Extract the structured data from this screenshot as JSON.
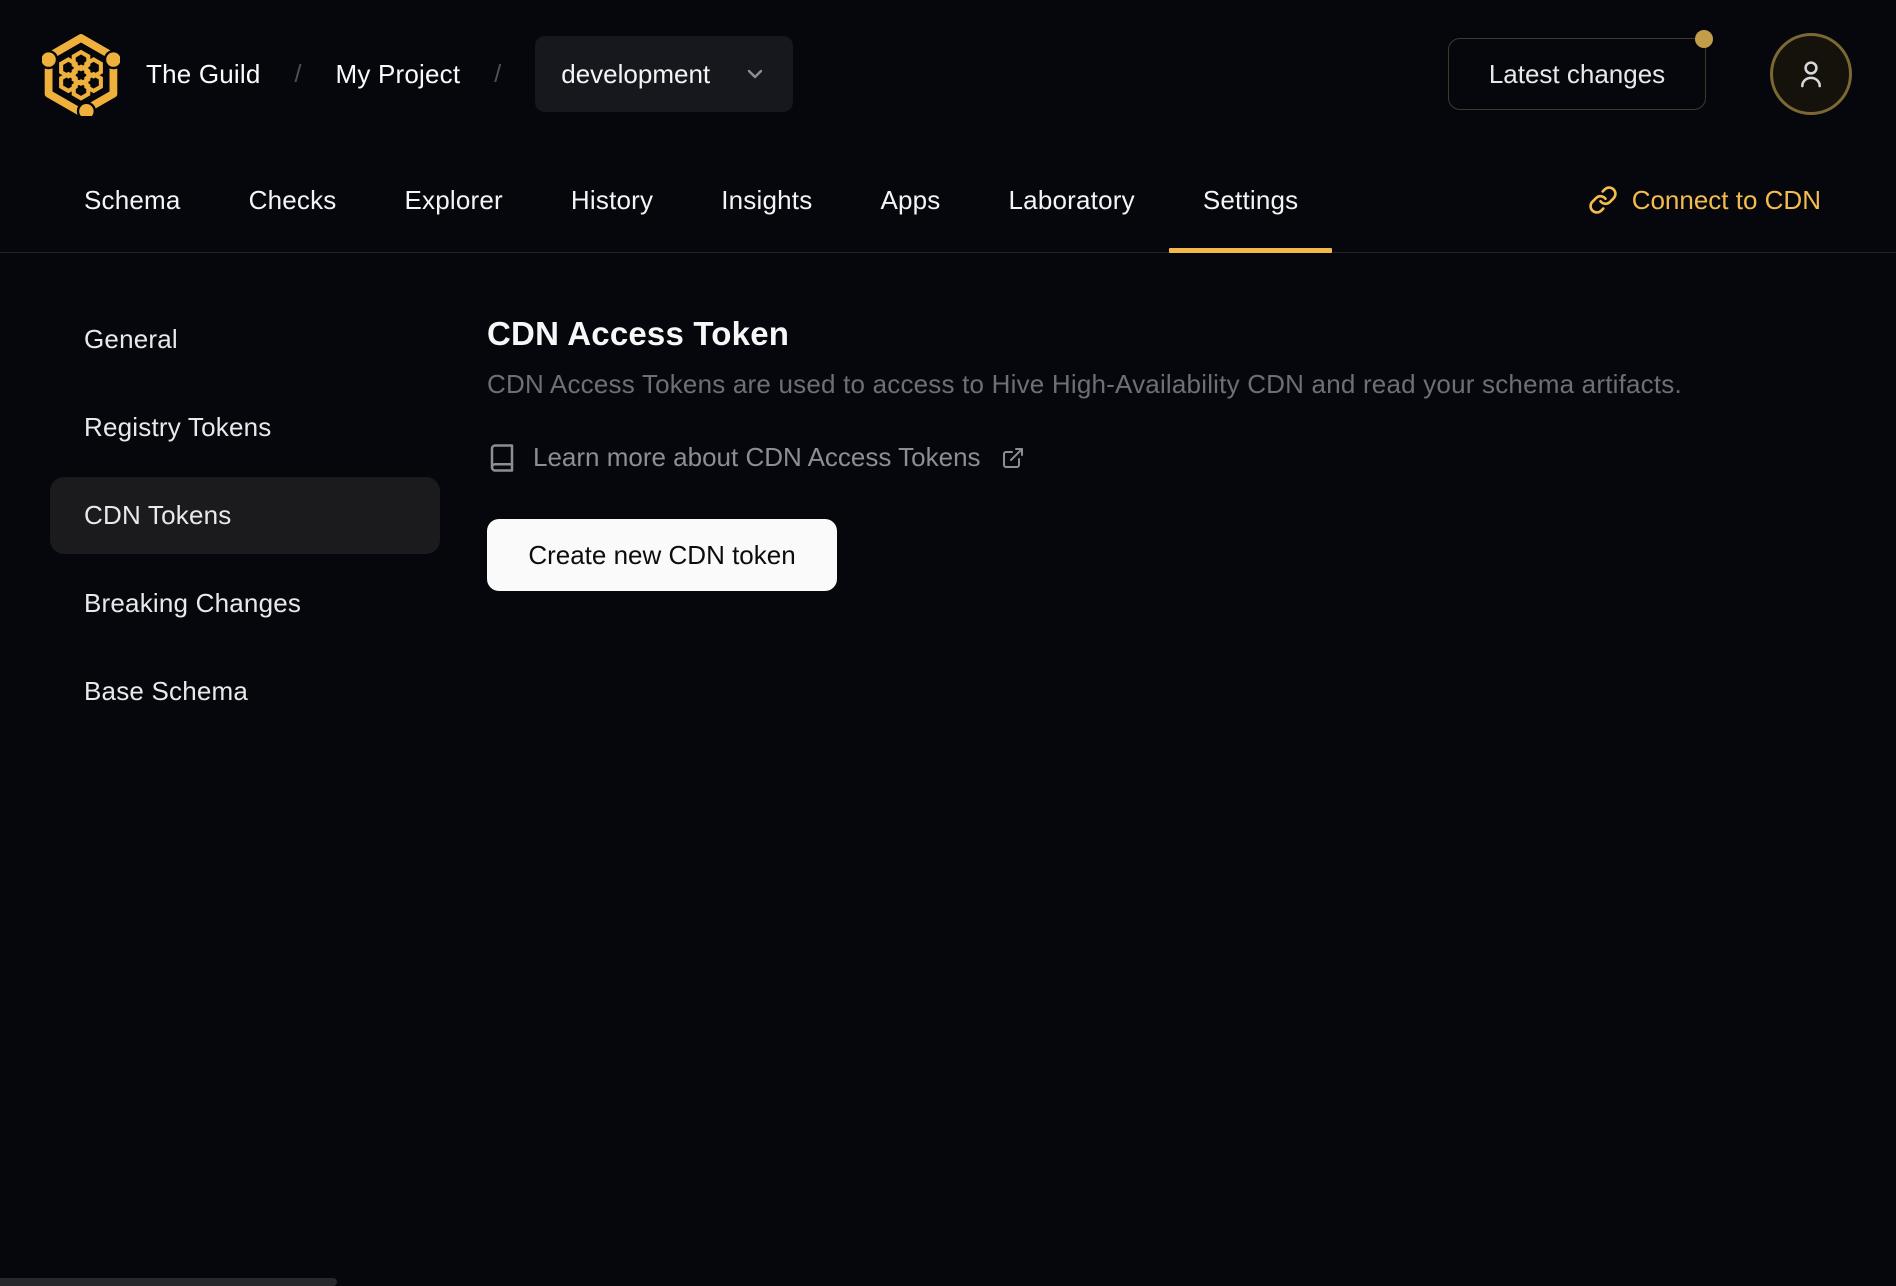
{
  "colors": {
    "accent_gold": "#f2b94a",
    "logo_gold": "#efb13c",
    "page_bg": "#05070c",
    "active_item_bg": "#1b1b1e",
    "button_bg": "#fafafa"
  },
  "breadcrumb": {
    "org": "The Guild",
    "separator": "/",
    "project": "My Project"
  },
  "target_select": {
    "value": "development"
  },
  "topbar": {
    "latest_changes_label": "Latest changes"
  },
  "nav": {
    "tabs": [
      {
        "label": "Schema"
      },
      {
        "label": "Checks"
      },
      {
        "label": "Explorer"
      },
      {
        "label": "History"
      },
      {
        "label": "Insights"
      },
      {
        "label": "Apps"
      },
      {
        "label": "Laboratory"
      },
      {
        "label": "Settings",
        "active": true
      }
    ],
    "connect_cdn_label": "Connect to CDN"
  },
  "sidebar": {
    "items": [
      {
        "label": "General"
      },
      {
        "label": "Registry Tokens"
      },
      {
        "label": "CDN Tokens",
        "active": true
      },
      {
        "label": "Breaking Changes"
      },
      {
        "label": "Base Schema"
      }
    ]
  },
  "main": {
    "title": "CDN Access Token",
    "description": "CDN Access Tokens are used to access to Hive High-Availability CDN and read your schema artifacts.",
    "learn_more_label": "Learn more about CDN Access Tokens",
    "create_button_label": "Create new CDN token"
  }
}
